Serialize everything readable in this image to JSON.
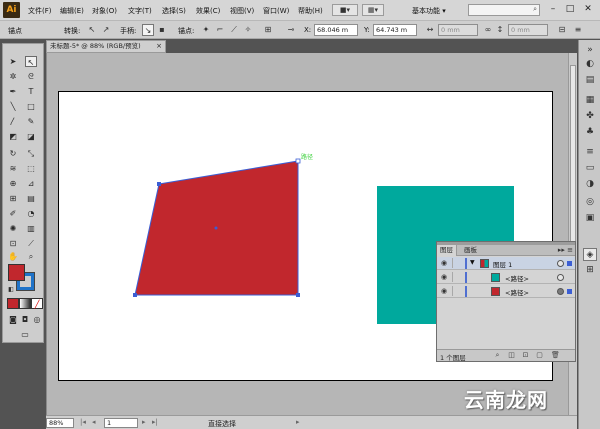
{
  "app": {
    "logo": "Ai",
    "workspace": "基本功能 ▾"
  },
  "menu": [
    "文件(F)",
    "编辑(E)",
    "对象(O)",
    "文字(T)",
    "选择(S)",
    "效果(C)",
    "视图(V)",
    "窗口(W)",
    "帮助(H)"
  ],
  "window_controls": {
    "minimize": "–",
    "maximize": "□",
    "close": "✕"
  },
  "control_bar": {
    "label_anchor": "锚点",
    "label_convert": "转换:",
    "label_handle": "手柄:",
    "label_anchor2": "锚点:",
    "x_label": "X:",
    "x_value": "68.046 m",
    "y_label": "Y:",
    "y_value": "64.743 m",
    "w_value": "0 mm",
    "h_value": "0 mm"
  },
  "document_tab": {
    "title": "未标题-5* @ 88% (RGB/预览)",
    "close": "×"
  },
  "canvas": {
    "anchor_hint": "路径",
    "shapes": [
      {
        "name": "red-quad",
        "color": "#c1272d"
      },
      {
        "name": "teal-rect",
        "color": "#00a99d"
      }
    ]
  },
  "status_bar": {
    "zoom": "88%",
    "page": "1",
    "tool": "直接选择"
  },
  "layers_panel": {
    "tabs": [
      "图层",
      "画板"
    ],
    "menu": "▸▸ ≡",
    "layer_name": "图层 1",
    "items": [
      {
        "name": "<路径>",
        "color": "#00a99d"
      },
      {
        "name": "<路径>",
        "color": "#c1272d"
      }
    ],
    "count": "1 个图层"
  },
  "colors": {
    "fill": "#c1272d",
    "stroke": "#1f73c9",
    "accent": "#3b5ed4"
  },
  "watermark": "云南龙网"
}
